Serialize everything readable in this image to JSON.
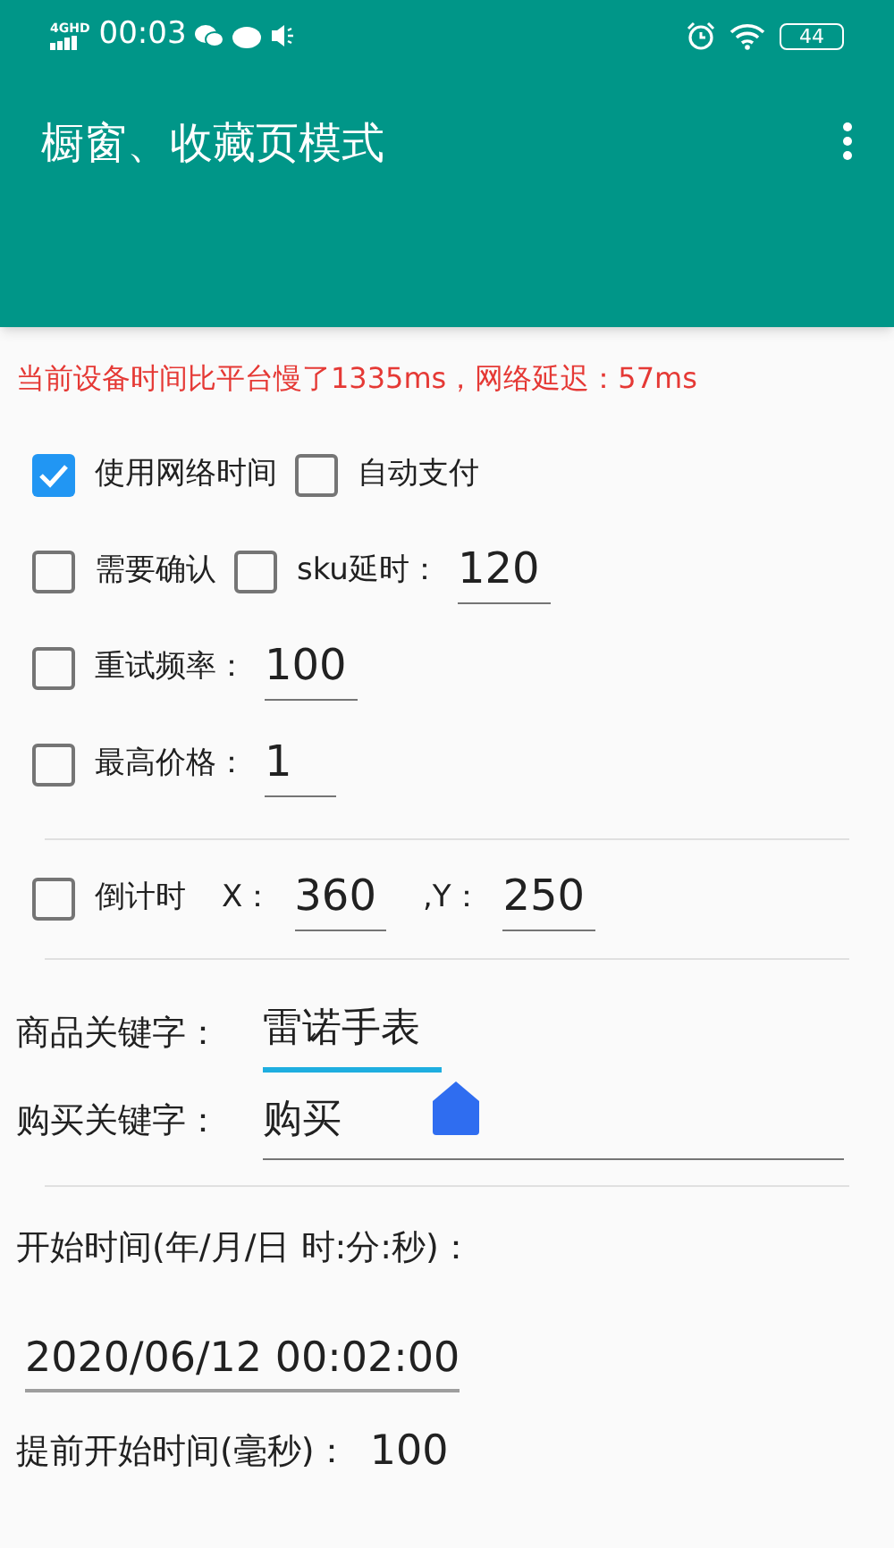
{
  "status_bar": {
    "network": "4GHD",
    "time": "00:03",
    "battery": "44"
  },
  "app_bar": {
    "title": "橱窗、收藏页模式"
  },
  "notice": "当前设备时间比平台慢了1335ms，网络延迟：57ms",
  "sections": [
    {
      "kind": "rows",
      "rows": [
        [
          {
            "kind": "checkbox",
            "label": "使用网络时间",
            "checked": true
          },
          {
            "kind": "checkbox",
            "label": "自动支付",
            "checked": false
          }
        ],
        [
          {
            "kind": "checkbox",
            "label": "需要确认",
            "checked": false
          },
          {
            "kind": "checkbox",
            "label": "sku延时：",
            "checked": false
          },
          {
            "kind": "field",
            "value": "120"
          }
        ],
        [
          {
            "kind": "checkbox",
            "label": "重试频率：",
            "checked": false
          },
          {
            "kind": "field",
            "value": "100"
          }
        ],
        [
          {
            "kind": "checkbox",
            "label": "最高价格：",
            "checked": false
          },
          {
            "kind": "field",
            "value": "1"
          }
        ]
      ]
    },
    {
      "kind": "rows",
      "rows": [
        [
          {
            "kind": "checkbox",
            "label": "倒计时",
            "checked": false
          },
          {
            "kind": "label",
            "text": "X："
          },
          {
            "kind": "field",
            "value": "360"
          },
          {
            "kind": "label",
            "text": ",Y："
          },
          {
            "kind": "field",
            "value": "250"
          }
        ]
      ]
    },
    {
      "kind": "keywords",
      "fields": [
        {
          "label": "商品关键字：",
          "value": "雷诺手表",
          "focused": true
        },
        {
          "label": "购买关键字：",
          "value": "购买",
          "focused": false
        }
      ]
    },
    {
      "kind": "time",
      "label": "开始时间(年/月/日 时:分:秒)：",
      "value": "2020/06/12 00:02:00",
      "advance_label": "提前开始时间(毫秒)：",
      "advance_value": "100"
    }
  ]
}
